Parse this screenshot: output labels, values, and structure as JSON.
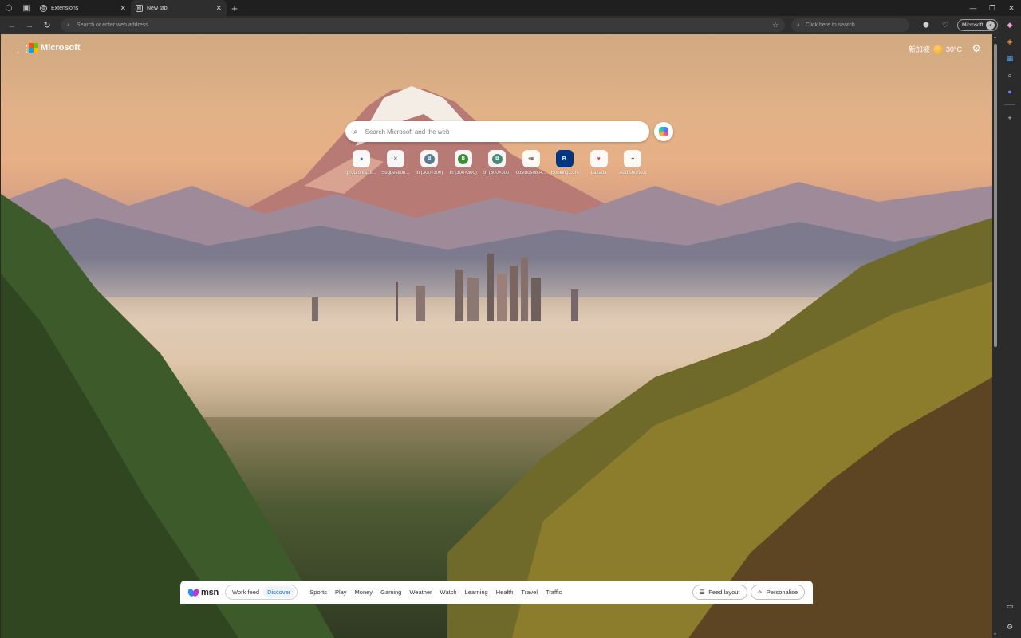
{
  "window": {
    "tabs": [
      {
        "title": "Extensions",
        "active": false
      },
      {
        "title": "New tab",
        "active": true
      }
    ],
    "new_tab_label": "+"
  },
  "toolbar": {
    "address_placeholder": "Search or enter web address",
    "search_placeholder": "Click here to search",
    "profile_label": "Microsoft"
  },
  "newtab": {
    "brand": "Microsoft",
    "weather": {
      "location": "新加坡",
      "temperature": "30°C"
    },
    "search_placeholder": "Search Microsoft and the web",
    "shortcuts": [
      {
        "label": "prod.ohrs.pl...",
        "icon": "edge-icon",
        "color": "#2a6fd6",
        "glyph": "●"
      },
      {
        "label": "Suggestion...",
        "icon": "network-icon",
        "color": "#1f7a99",
        "glyph": "✕"
      },
      {
        "label": "th (300×300)",
        "icon": "b-chip-icon",
        "color": "#5a7b8f",
        "glyph": "B"
      },
      {
        "label": "th (300×300)",
        "icon": "b-chip-icon",
        "color": "#3f8a3a",
        "glyph": "B"
      },
      {
        "label": "th (300×300)",
        "icon": "b-chip-icon",
        "color": "#4a8a74",
        "glyph": "B"
      },
      {
        "label": "cosmos08 A...",
        "icon": "cosmos-icon",
        "color": "#777777",
        "glyph": "•■"
      },
      {
        "label": "Booking.com",
        "icon": "booking-icon",
        "color": "#003580",
        "glyph": "B."
      },
      {
        "label": "Lazada",
        "icon": "lazada-icon",
        "color": "#f0356b",
        "glyph": "♥"
      },
      {
        "label": "Add shortcut",
        "icon": "plus-icon",
        "color": "#555555",
        "glyph": "+"
      }
    ]
  },
  "msn": {
    "brand": "msn",
    "feed_toggle": [
      "Work feed",
      "Discover"
    ],
    "selected_feed": "Discover",
    "categories": [
      "Sports",
      "Play",
      "Money",
      "Gaming",
      "Weather",
      "Watch",
      "Learning",
      "Health",
      "Travel",
      "Traffic"
    ],
    "feed_layout_label": "Feed layout",
    "personalise_label": "Personalise"
  }
}
